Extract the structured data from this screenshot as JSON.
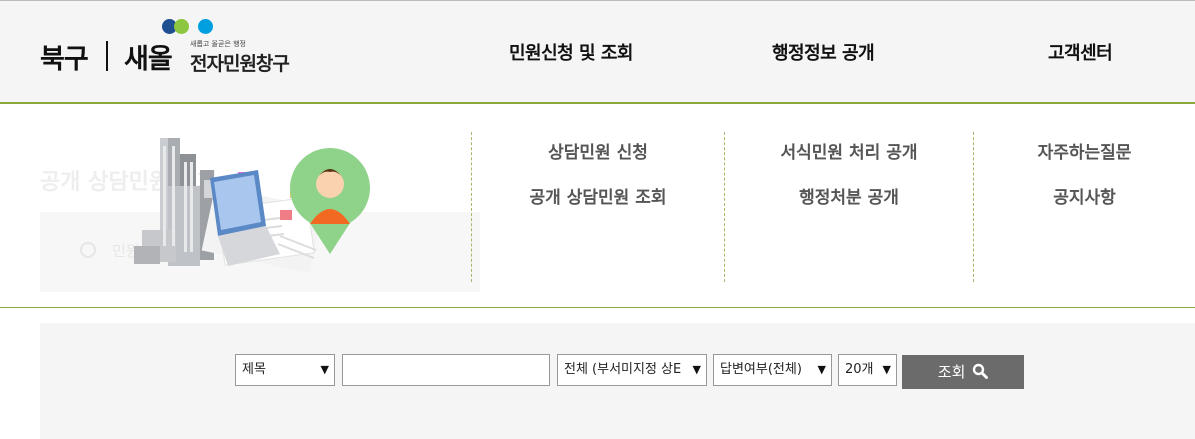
{
  "logo": {
    "district": "북구",
    "brand": "새올",
    "slogan": "새롭고 올곧은 행정",
    "subtitle": "전자민원창구",
    "dot_colors": [
      "#1d4f91",
      "#8dc63f",
      "#00a0e0"
    ]
  },
  "nav": {
    "items": [
      {
        "label": "민원신청 및 조회"
      },
      {
        "label": "행정정보 공개"
      },
      {
        "label": "고객센터"
      }
    ]
  },
  "background": {
    "page_title": "공개 상담민원 조회",
    "radio_label": "민원"
  },
  "dropdown": {
    "columns": [
      {
        "items": [
          "상담민원 신청",
          "공개 상담민원 조회"
        ]
      },
      {
        "items": [
          "서식민원 처리 공개",
          "행정처분 공개"
        ]
      },
      {
        "items": [
          "자주하는질문",
          "공지사항"
        ]
      }
    ]
  },
  "search": {
    "field_select": "제목",
    "keyword_value": "",
    "dept_select": "전체 (부서미지정 상E",
    "answer_select": "답변여부(전체)",
    "count_select": "20개",
    "button_label": "조회"
  },
  "colors": {
    "accent": "#8aa83c",
    "button": "#6b6b6b",
    "avatar_bg": "#8fd28a",
    "person": "#f26a21"
  }
}
